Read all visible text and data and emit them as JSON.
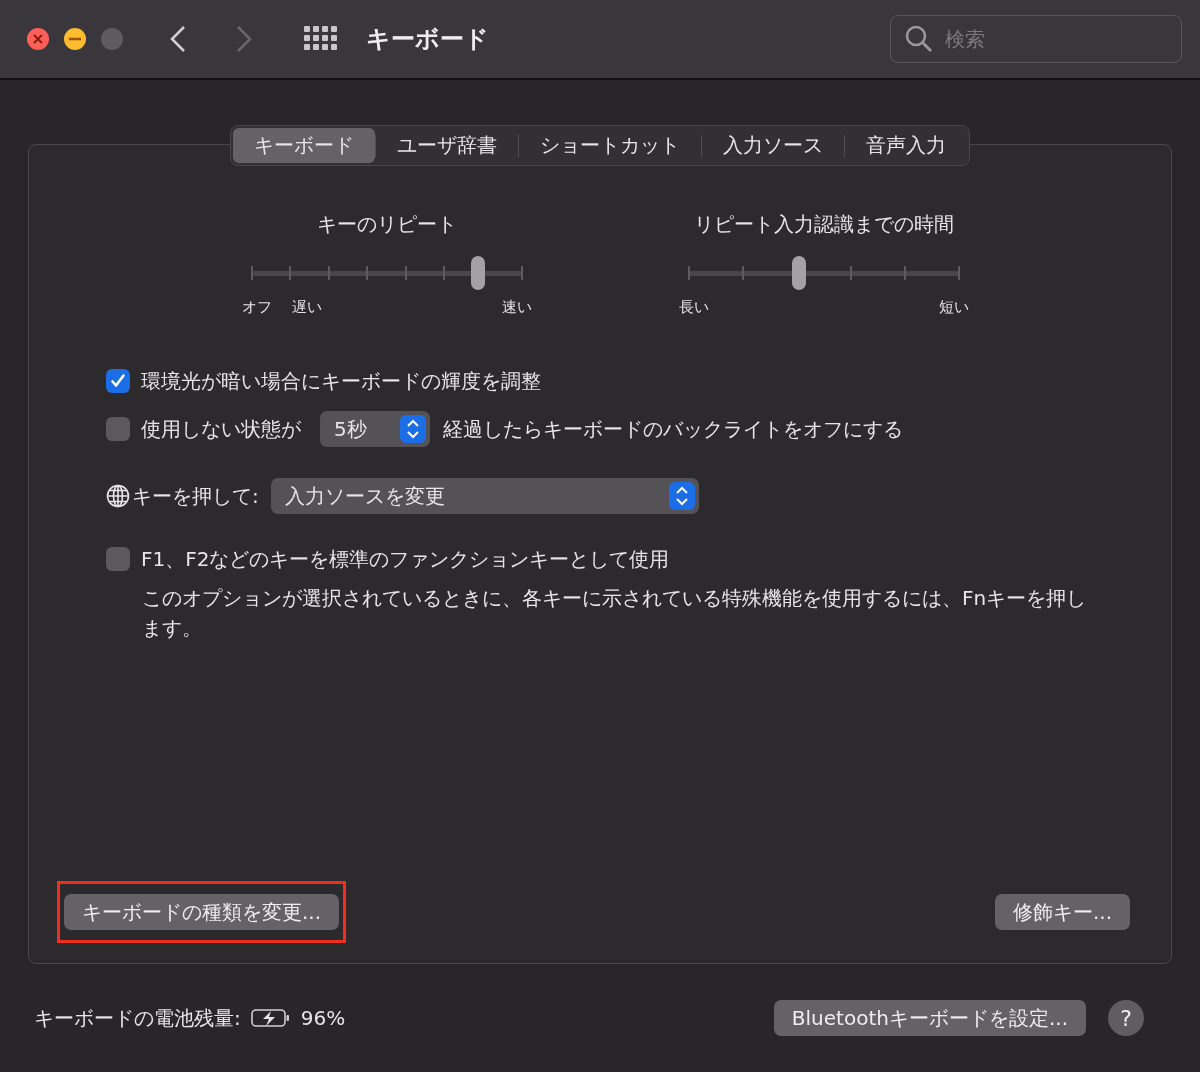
{
  "window": {
    "title": "キーボード",
    "search": {
      "placeholder": "検索"
    }
  },
  "tabs": [
    {
      "label": "キーボード",
      "selected": true
    },
    {
      "label": "ユーザ辞書",
      "selected": false
    },
    {
      "label": "ショートカット",
      "selected": false
    },
    {
      "label": "入力ソース",
      "selected": false
    },
    {
      "label": "音声入力",
      "selected": false
    }
  ],
  "sliders": [
    {
      "title": "キーのリピート",
      "level": 0.84,
      "labels": [
        "オフ",
        "遅い",
        "速い"
      ]
    },
    {
      "title": "リピート入力認識までの時間",
      "level": 0.41,
      "labels": [
        "長い",
        "短い"
      ]
    }
  ],
  "options": [
    {
      "kind": "checkbox",
      "label": "環境光が暗い場合にキーボードの輝度を調整",
      "checked": true
    },
    {
      "kind": "checkbox-popup",
      "label": "使用しない状態が",
      "value": "5秒",
      "label_after": "経過したらキーボードのバックライトをオフにする",
      "checked": false
    },
    {
      "kind": "popup",
      "label": "キーを押して:",
      "value": "入力ソースを変更"
    },
    {
      "kind": "checkbox",
      "label": "F1、F2などのキーを標準のファンクションキーとして使用",
      "checked": false,
      "note": "このオプションが選択されているときに、各キーに示されている特殊機能を使用するには、Fnキーを押します。"
    }
  ],
  "panel_buttons": [
    {
      "label": "キーボードの種類を変更...",
      "highlighted": true
    },
    {
      "label": "修飾キー...",
      "highlighted": false
    }
  ],
  "footer": {
    "battery_label": "キーボードの電池残量:",
    "battery_percent": "96%",
    "bluetooth_button": "Bluetoothキーボードを設定...",
    "help": "?"
  }
}
